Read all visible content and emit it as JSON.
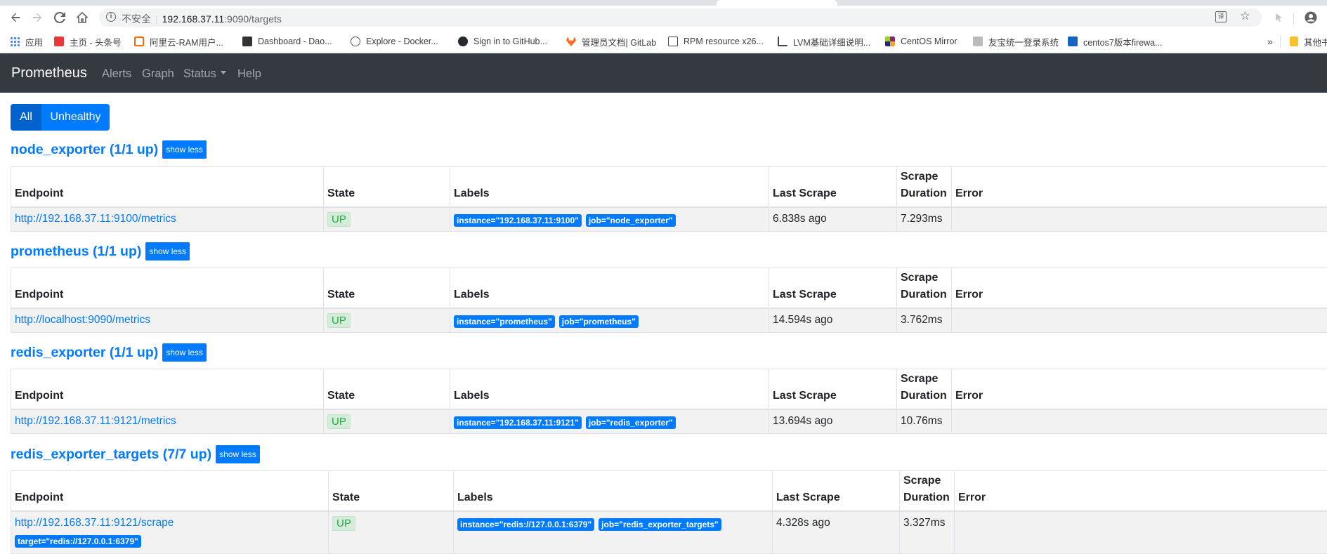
{
  "browser": {
    "url_security": "不安全",
    "url_host": "192.168.37.11",
    "url_rest": ":9090/targets",
    "bookmarks": [
      {
        "label": "应用",
        "icon": "apps-grid-icon",
        "color": "#4285f4"
      },
      {
        "label": "主页 - 头条号",
        "icon": "toutiao-icon",
        "color": "#e53935"
      },
      {
        "label": "阿里云-RAM用户...",
        "icon": "aliyun-icon",
        "color": "#ff6a00"
      },
      {
        "label": "Dashboard - Dao...",
        "icon": "daocloud-icon",
        "color": "#333333"
      },
      {
        "label": "Explore - Docker...",
        "icon": "docker-icon",
        "color": "#555555"
      },
      {
        "label": "Sign in to GitHub...",
        "icon": "github-icon",
        "color": "#24292e"
      },
      {
        "label": "管理员文档| GitLab",
        "icon": "gitlab-icon",
        "color": "#fc6d26"
      },
      {
        "label": "RPM resource x26...",
        "icon": "rpm-icon",
        "color": "#444444"
      },
      {
        "label": "LVM基础详细说明...",
        "icon": "lvm-icon",
        "color": "#444444"
      },
      {
        "label": "CentOS Mirror",
        "icon": "centos-icon",
        "color": "#932279"
      },
      {
        "label": "友宝统一登录系统",
        "icon": "ubox-icon",
        "color": "#666666"
      },
      {
        "label": "centos7版本firewa...",
        "icon": "cnblogs-icon",
        "color": "#1565c0"
      }
    ],
    "more_bookmarks": "»",
    "other_bookmarks": "其他书"
  },
  "navbar": {
    "brand": "Prometheus",
    "alerts": "Alerts",
    "graph": "Graph",
    "status": "Status",
    "help": "Help"
  },
  "filters": {
    "all": "All",
    "unhealthy": "Unhealthy"
  },
  "table_headers": {
    "endpoint": "Endpoint",
    "state": "State",
    "labels": "Labels",
    "last_scrape": "Last Scrape",
    "scrape_duration": "Scrape Duration",
    "error": "Error"
  },
  "jobs": [
    {
      "title": "node_exporter (1/1 up)",
      "toggle": "show less",
      "rows": [
        {
          "endpoint": "http://192.168.37.11:9100/metrics",
          "state": "UP",
          "labels": [
            "instance=\"192.168.37.11:9100\"",
            "job=\"node_exporter\""
          ],
          "last_scrape": "6.838s ago",
          "duration": "7.293ms",
          "error": ""
        }
      ]
    },
    {
      "title": "prometheus (1/1 up)",
      "toggle": "show less",
      "rows": [
        {
          "endpoint": "http://localhost:9090/metrics",
          "state": "UP",
          "labels": [
            "instance=\"prometheus\"",
            "job=\"prometheus\""
          ],
          "last_scrape": "14.594s ago",
          "duration": "3.762ms",
          "error": ""
        }
      ]
    },
    {
      "title": "redis_exporter (1/1 up)",
      "toggle": "show less",
      "rows": [
        {
          "endpoint": "http://192.168.37.11:9121/metrics",
          "state": "UP",
          "labels": [
            "instance=\"192.168.37.11:9121\"",
            "job=\"redis_exporter\""
          ],
          "last_scrape": "13.694s ago",
          "duration": "10.76ms",
          "error": ""
        }
      ]
    },
    {
      "title": "redis_exporter_targets (7/7 up)",
      "toggle": "show less",
      "rows": [
        {
          "endpoint": "http://192.168.37.11:9121/scrape",
          "endpoint_label": "target=\"redis://127.0.0.1:6379\"",
          "state": "UP",
          "labels": [
            "instance=\"redis://127.0.0.1:6379\"",
            "job=\"redis_exporter_targets\""
          ],
          "last_scrape": "4.328s ago",
          "duration": "3.327ms",
          "error": ""
        }
      ]
    }
  ]
}
